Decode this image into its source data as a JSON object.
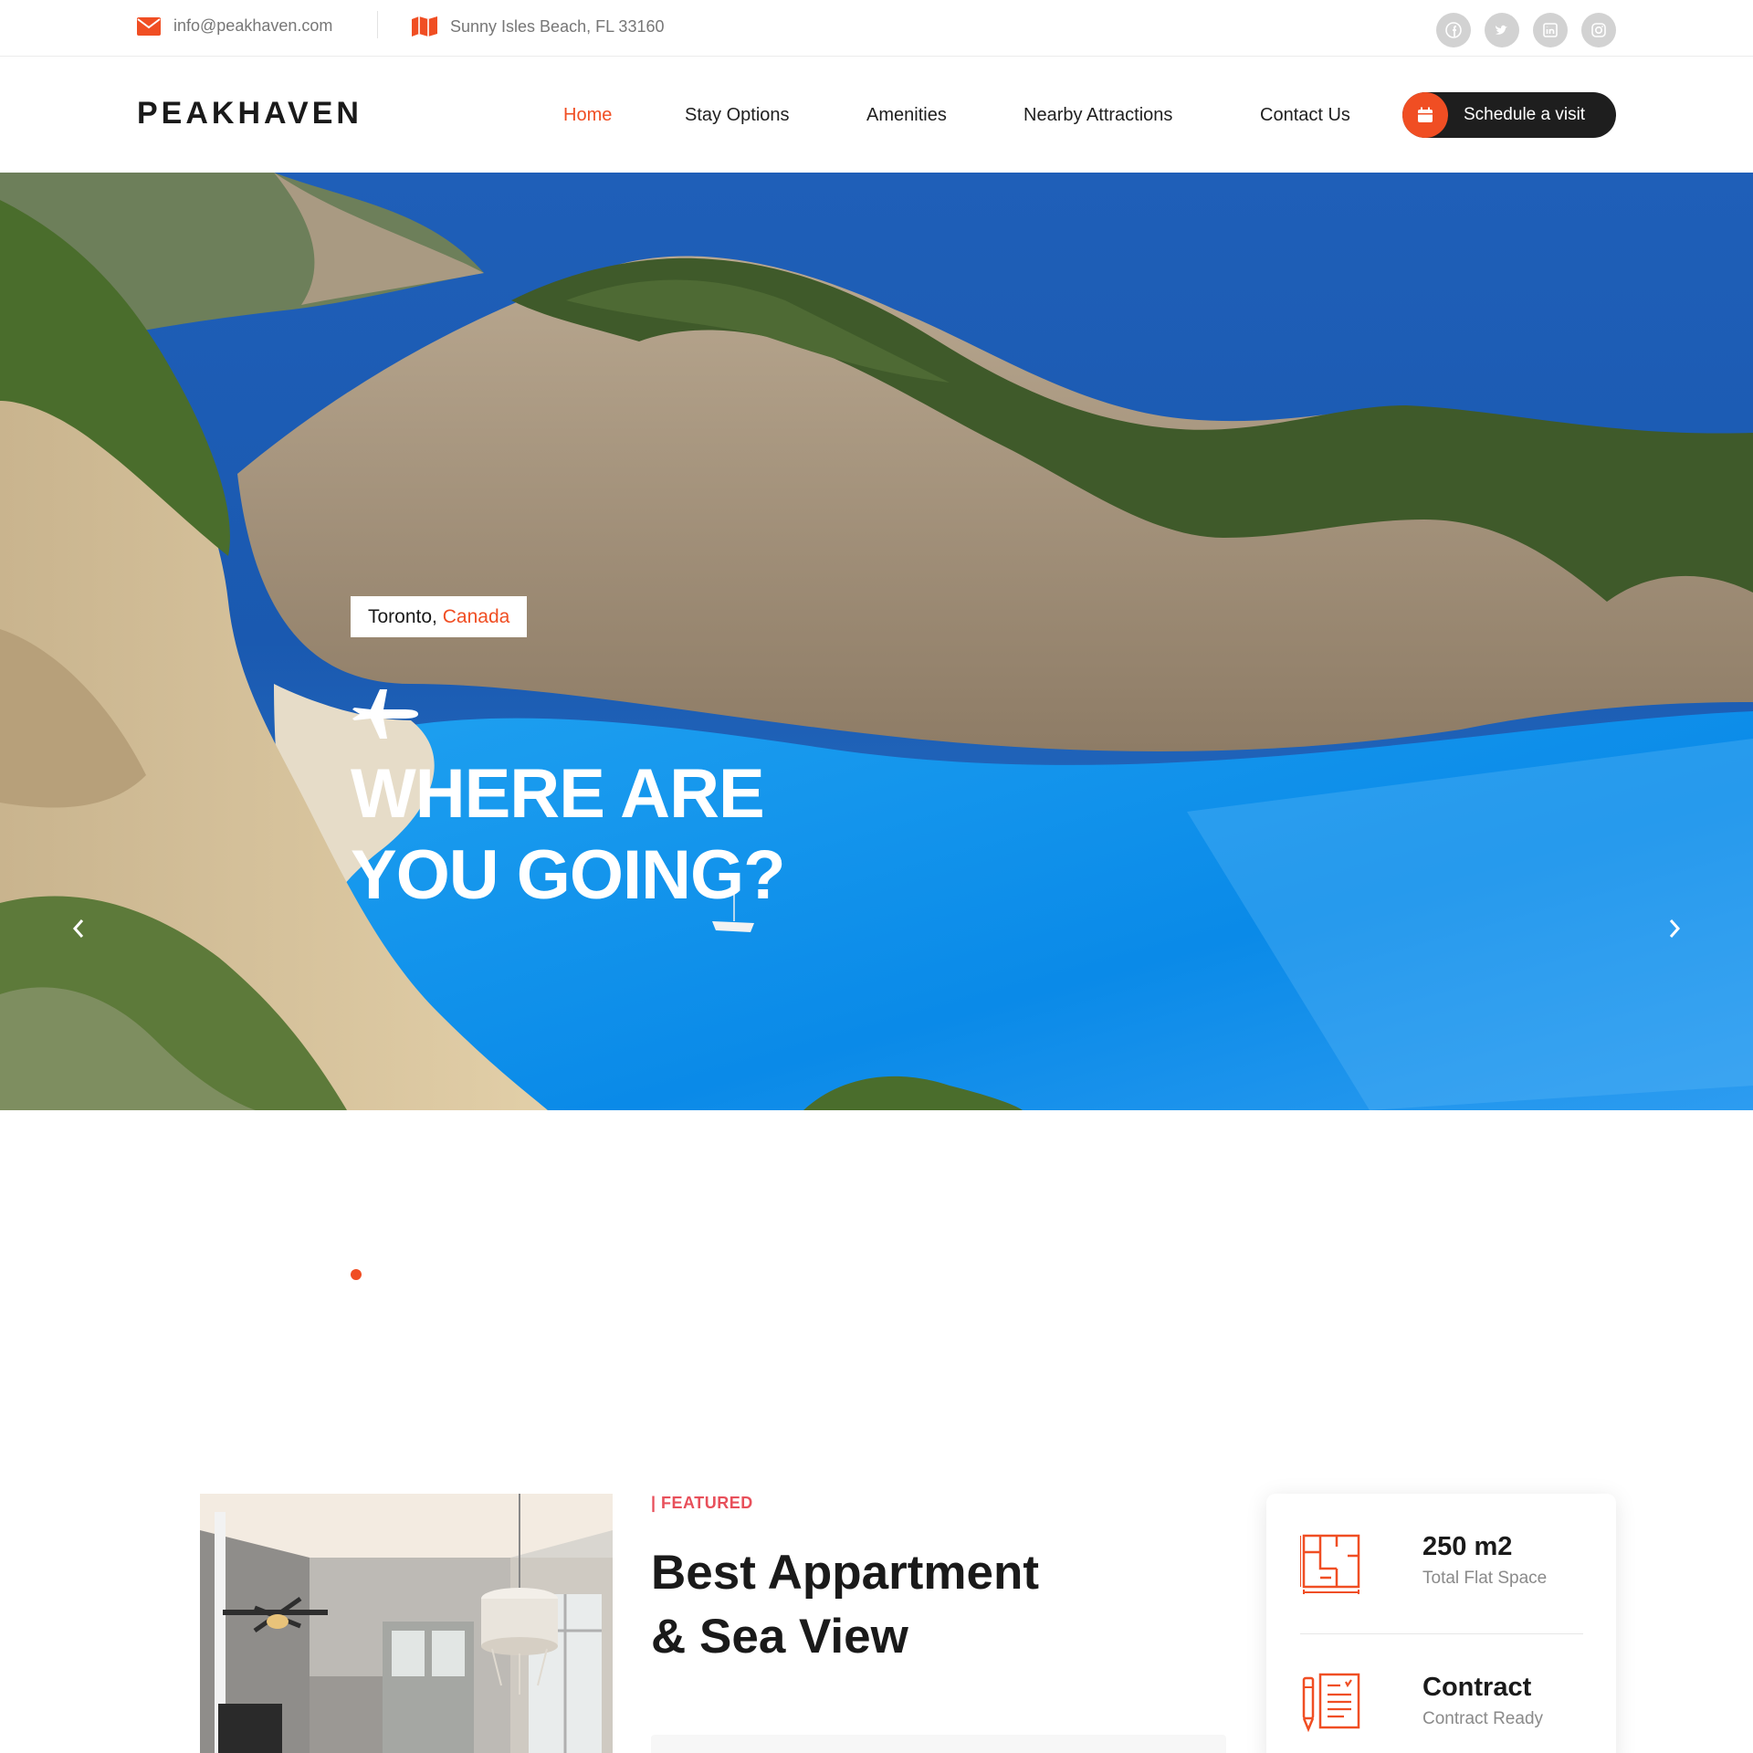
{
  "topbar": {
    "email": "info@peakhaven.com",
    "address": "Sunny Isles Beach, FL 33160",
    "social": [
      "facebook-icon",
      "twitter-icon",
      "linkedin-icon",
      "instagram-icon"
    ]
  },
  "header": {
    "logo": "PEAKHAVEN",
    "nav": [
      "Home",
      "Stay Options",
      "Amenities",
      "Nearby Attractions",
      "Contact Us"
    ],
    "active_nav": "Home",
    "cta_label": "Schedule a visit"
  },
  "hero": {
    "city": "Toronto,",
    "country": "Canada",
    "title_line1": "WHERE ARE",
    "title_line2": "YOU GOING?"
  },
  "featured": {
    "tag": "| FEATURED",
    "title_line1": "Best Appartment",
    "title_line2": "& Sea View"
  },
  "stats": [
    {
      "value": "250 m2",
      "label": "Total Flat Space",
      "icon": "floorplan-icon"
    },
    {
      "value": "Contract",
      "label": "Contract Ready",
      "icon": "contract-icon"
    }
  ],
  "colors": {
    "accent": "#f04e23",
    "dark": "#1e1e1e",
    "tag": "#e8505b"
  }
}
